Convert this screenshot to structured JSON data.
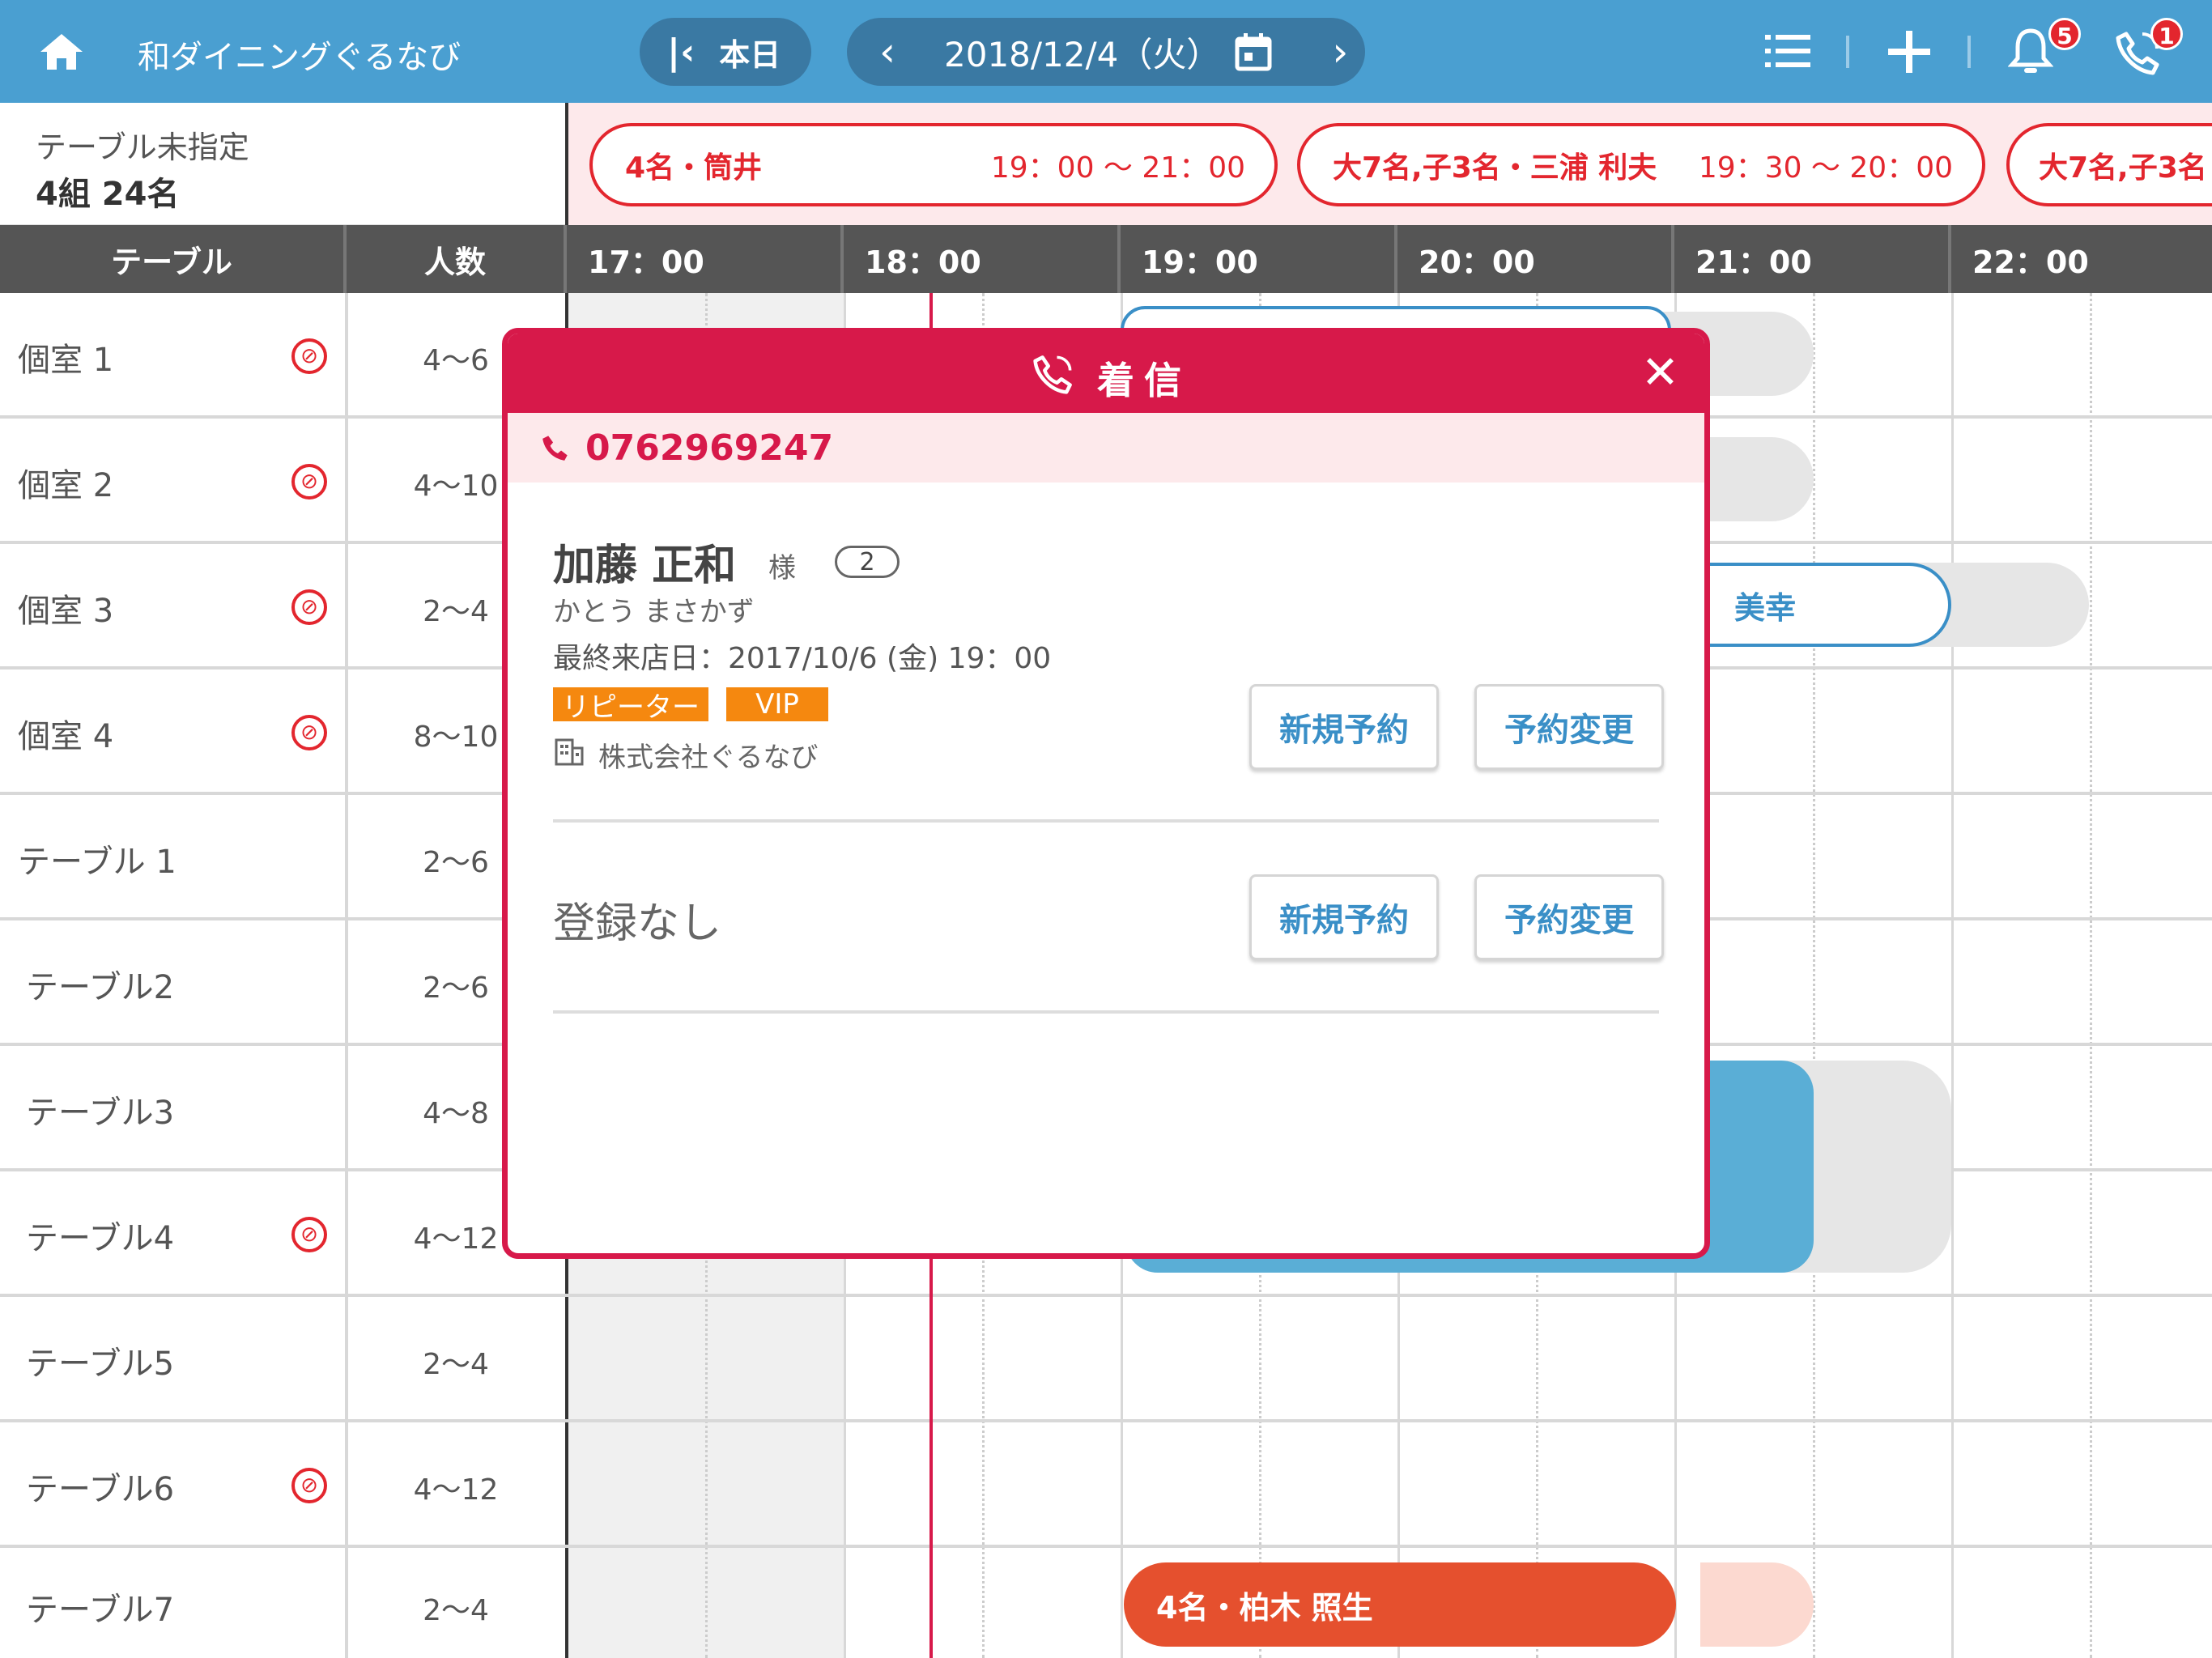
{
  "header": {
    "store_name": "和ダイニングぐるなび",
    "today_label": "本日",
    "date": "2018/12/4（火）",
    "notification_count": "5",
    "call_count": "1"
  },
  "unassigned": {
    "title": "テーブル未指定",
    "summary": "4組 24名",
    "reservations": [
      {
        "name": "4名・筒井",
        "time": "19：00 〜 21：00"
      },
      {
        "name": "大7名,子3名・三浦 利夫",
        "time": "19：30 〜 20：00"
      },
      {
        "name": "大7名,子3名",
        "time": ""
      }
    ]
  },
  "columns": {
    "table": "テーブル",
    "people": "人数",
    "times": [
      "17：00",
      "18：00",
      "19：00",
      "20：00",
      "21：00",
      "22：00"
    ]
  },
  "rows": [
    {
      "name": "個室 1",
      "capacity": "4〜6",
      "no_smoking": true
    },
    {
      "name": "個室 2",
      "capacity": "4〜10",
      "no_smoking": true
    },
    {
      "name": "個室 3",
      "capacity": "2〜4",
      "no_smoking": true
    },
    {
      "name": "個室 4",
      "capacity": "8〜10",
      "no_smoking": true
    },
    {
      "name": "テーブル 1",
      "capacity": "2〜6",
      "no_smoking": false
    },
    {
      "name": "テーブル2",
      "capacity": "2〜6",
      "no_smoking": false
    },
    {
      "name": "テーブル3",
      "capacity": "4〜8",
      "no_smoking": false
    },
    {
      "name": "テーブル4",
      "capacity": "4〜12",
      "no_smoking": true
    },
    {
      "name": "テーブル5",
      "capacity": "2〜4",
      "no_smoking": false
    },
    {
      "name": "テーブル6",
      "capacity": "4〜12",
      "no_smoking": true
    },
    {
      "name": "テーブル7",
      "capacity": "2〜4",
      "no_smoking": false
    }
  ],
  "timeline": {
    "row3_reservation": "美幸",
    "row11_reservation": "4名・柏木 照生"
  },
  "modal": {
    "title": "着信",
    "phone": "0762969247",
    "customer": {
      "name": "加藤 正和",
      "honorific": "様",
      "visit_count": "2",
      "kana": "かとう まさかず",
      "last_visit": "最終来店日：2017/10/6 (金) 19：00",
      "tags": [
        "リピーター",
        "VIP"
      ],
      "company": "株式会社ぐるなび"
    },
    "new_reservation": "新規予約",
    "change_reservation": "予約変更",
    "unregistered": "登録なし"
  },
  "colors": {
    "header_blue": "#4a9fd1",
    "modal_red": "#d7194a",
    "reservation_red": "#e3262e",
    "reservation_blue": "#5aaed6",
    "reservation_orange": "#e5502e",
    "tag_orange": "#f5880f"
  }
}
